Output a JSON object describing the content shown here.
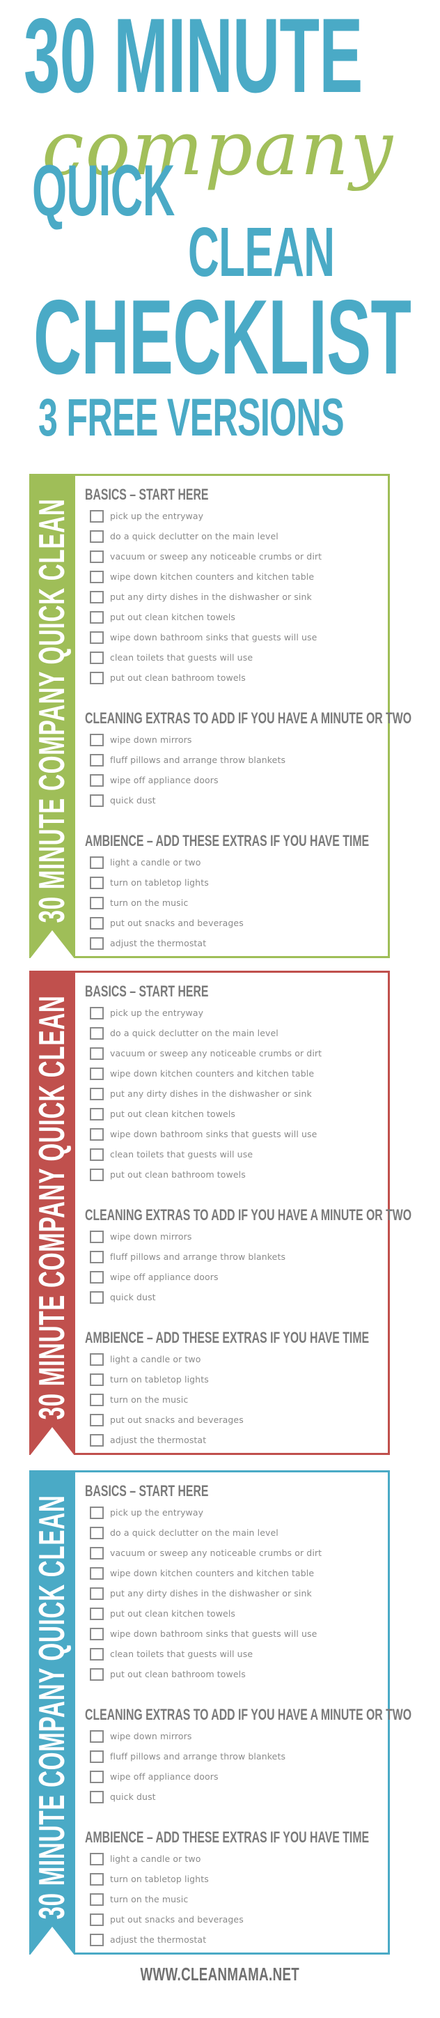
{
  "header": {
    "line1": "30 MINUTE",
    "line2": "company",
    "line3": "QUICK",
    "line4": "CLEAN",
    "line5": "CHECKLIST",
    "line6": "3 FREE VERSIONS"
  },
  "colors": {
    "title_blue": "#4aaac6",
    "script_green": "#a2bf5a",
    "text_gray": "#7a7a7a",
    "green": "#9fbe58",
    "red": "#c0504d",
    "blue": "#4aaac6"
  },
  "cards": [
    {
      "color_name": "green",
      "banner": "30 MINUTE COMPANY QUICK CLEAN",
      "sections": [
        {
          "title": "BASICS – START HERE",
          "items": [
            "pick up the entryway",
            "do a quick declutter on the main level",
            "vacuum or sweep any noticeable crumbs or dirt",
            "wipe down kitchen counters and kitchen table",
            "put any dirty dishes in the dishwasher or sink",
            "put out clean kitchen towels",
            "wipe down bathroom sinks that guests will use",
            "clean toilets that guests will use",
            "put out clean bathroom towels"
          ]
        },
        {
          "title": "CLEANING EXTRAS TO ADD IF YOU HAVE A MINUTE OR TWO",
          "items": [
            "wipe down mirrors",
            "fluff pillows and arrange throw blankets",
            "wipe off appliance doors",
            "quick dust"
          ]
        },
        {
          "title": "AMBIENCE – ADD THESE EXTRAS IF YOU HAVE TIME",
          "items": [
            "light a candle or two",
            "turn on tabletop lights",
            "turn on the music",
            "put out snacks and beverages",
            "adjust the thermostat"
          ]
        }
      ]
    },
    {
      "color_name": "red",
      "banner": "30 MINUTE COMPANY QUICK CLEAN",
      "sections": [
        {
          "title": "BASICS – START HERE",
          "items": [
            "pick up the entryway",
            "do a quick declutter on the main level",
            "vacuum or sweep any noticeable crumbs or dirt",
            "wipe down kitchen counters and kitchen table",
            "put any dirty dishes in the dishwasher or sink",
            "put out clean kitchen towels",
            "wipe down bathroom sinks that guests will use",
            "clean toilets that guests will use",
            "put out clean bathroom towels"
          ]
        },
        {
          "title": "CLEANING EXTRAS TO ADD IF YOU HAVE A MINUTE OR TWO",
          "items": [
            "wipe down mirrors",
            "fluff pillows and arrange throw blankets",
            "wipe off appliance doors",
            "quick dust"
          ]
        },
        {
          "title": "AMBIENCE – ADD THESE EXTRAS IF YOU HAVE TIME",
          "items": [
            "light a candle or two",
            "turn on tabletop lights",
            "turn on the music",
            "put out snacks and beverages",
            "adjust the thermostat"
          ]
        }
      ]
    },
    {
      "color_name": "blue",
      "banner": "30 MINUTE COMPANY QUICK CLEAN",
      "sections": [
        {
          "title": "BASICS – START HERE",
          "items": [
            "pick up the entryway",
            "do a quick declutter on the main level",
            "vacuum or sweep any noticeable crumbs or dirt",
            "wipe down kitchen counters and kitchen table",
            "put any dirty dishes in the dishwasher or sink",
            "put out clean kitchen towels",
            "wipe down bathroom sinks that guests will use",
            "clean toilets that guests will use",
            "put out clean bathroom towels"
          ]
        },
        {
          "title": "CLEANING EXTRAS TO ADD IF YOU HAVE A MINUTE OR TWO",
          "items": [
            "wipe down mirrors",
            "fluff pillows and arrange throw blankets",
            "wipe off appliance doors",
            "quick dust"
          ]
        },
        {
          "title": "AMBIENCE – ADD THESE EXTRAS IF YOU HAVE TIME",
          "items": [
            "light a candle or two",
            "turn on tabletop lights",
            "turn on the music",
            "put out snacks and beverages",
            "adjust the thermostat"
          ]
        }
      ]
    }
  ],
  "footer": {
    "url": "WWW.CLEANMAMA.NET"
  }
}
